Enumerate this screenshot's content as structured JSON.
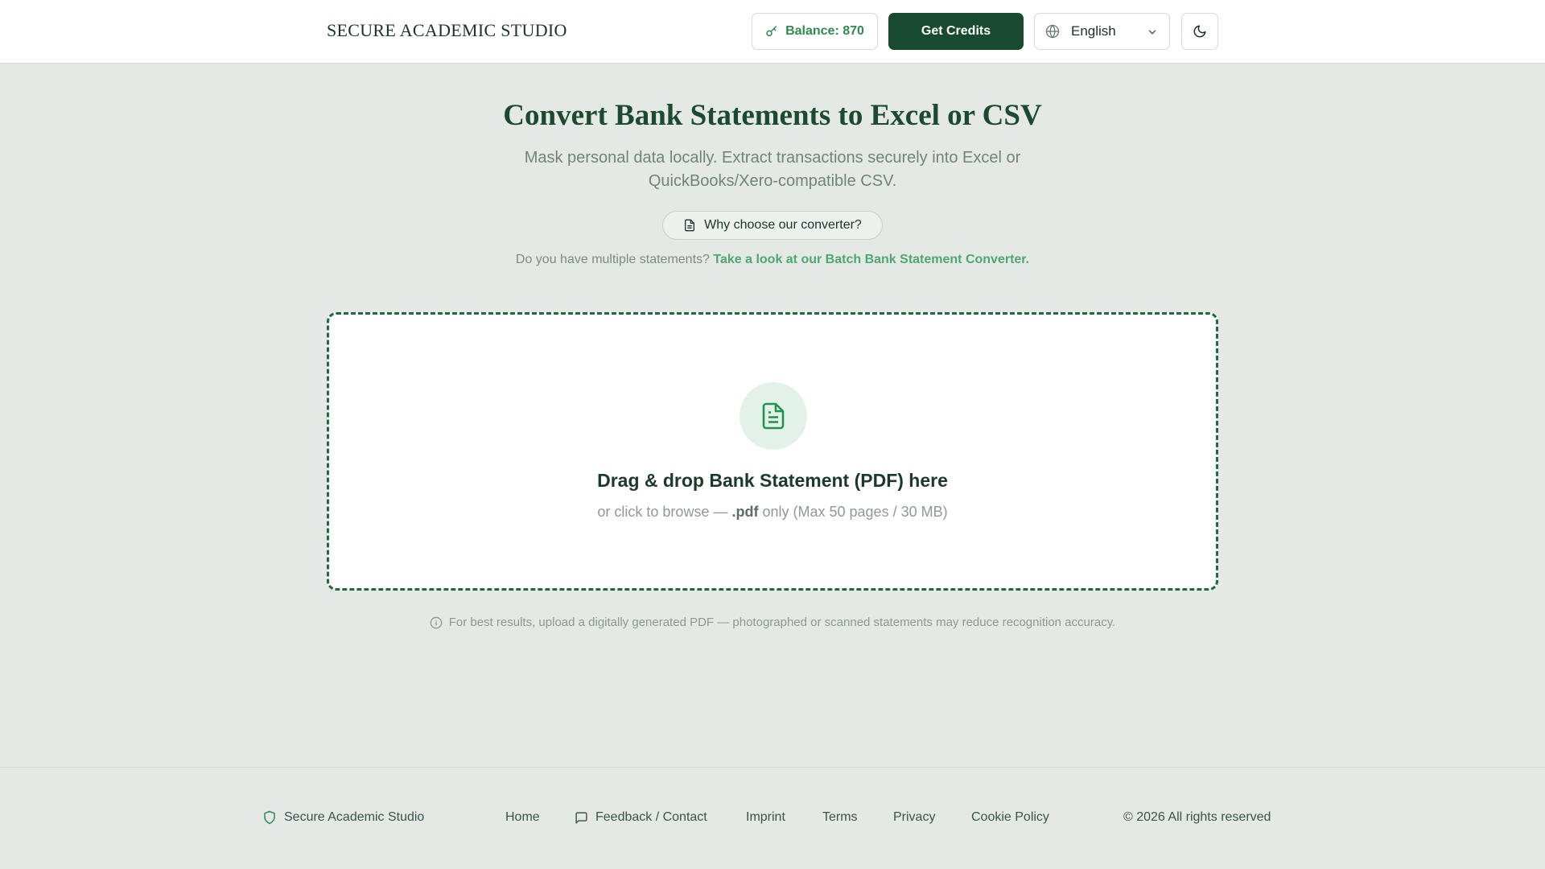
{
  "header": {
    "brand": "SECURE ACADEMIC STUDIO",
    "balance_label": "Balance: 870",
    "credits_label": "Get Credits",
    "language": "English"
  },
  "hero": {
    "title": "Convert Bank Statements to Excel or CSV",
    "subtitle": "Mask personal data locally. Extract transactions securely into Excel or QuickBooks/Xero-compatible CSV.",
    "why_label": "Why choose our converter?",
    "multi_question": "Do you have multiple statements?",
    "multi_link": "Take a look at our Batch Bank Statement Converter."
  },
  "dropzone": {
    "title": "Drag & drop Bank Statement (PDF) here",
    "sub_prefix": "or click to browse —",
    "sub_ext": ".pdf",
    "sub_suffix": "only (Max 50 pages / 30 MB)"
  },
  "hint": "For best results, upload a digitally generated PDF — photographed or scanned statements may reduce recognition accuracy.",
  "footer": {
    "brand": "Secure Academic Studio",
    "links": {
      "home": "Home",
      "feedback": "Feedback / Contact",
      "imprint": "Imprint",
      "terms": "Terms",
      "privacy": "Privacy",
      "cookie": "Cookie Policy"
    },
    "copyright": "© 2026 All rights reserved"
  },
  "colors": {
    "accent": "#174a2f",
    "link": "#4ea86e",
    "background": "#e5e9e5"
  },
  "icons": [
    "key-icon",
    "globe-icon",
    "chevron-down-icon",
    "moon-icon",
    "document-icon",
    "info-icon",
    "shield-icon",
    "chat-icon"
  ]
}
